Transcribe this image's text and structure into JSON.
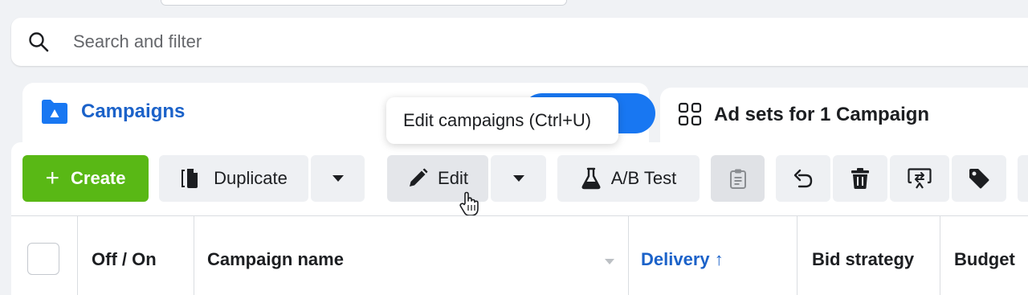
{
  "search": {
    "placeholder": "Search and filter"
  },
  "tabs": {
    "campaigns": "Campaigns",
    "adsets": "Ad sets for 1 Campaign"
  },
  "toolbar": {
    "create": "Create",
    "duplicate": "Duplicate",
    "edit": "Edit",
    "ab_test": "A/B Test"
  },
  "tooltip": {
    "text": "Edit campaigns (Ctrl+U)"
  },
  "table": {
    "columns": [
      "Off / On",
      "Campaign name",
      "Delivery ↑",
      "Bid strategy",
      "Budget"
    ]
  },
  "colors": {
    "accent_blue": "#1b62c9",
    "create_green": "#59b815",
    "pill_blue": "#1877f2"
  },
  "icons": [
    "search-icon",
    "folder-icon",
    "grid-icon",
    "plus-icon",
    "duplicate-icon",
    "chevron-down-icon",
    "pencil-icon",
    "flask-icon",
    "clipboard-icon",
    "undo-icon",
    "trash-icon",
    "preview-icon",
    "tag-icon",
    "hand-cursor-icon",
    "sort-caret-icon"
  ]
}
